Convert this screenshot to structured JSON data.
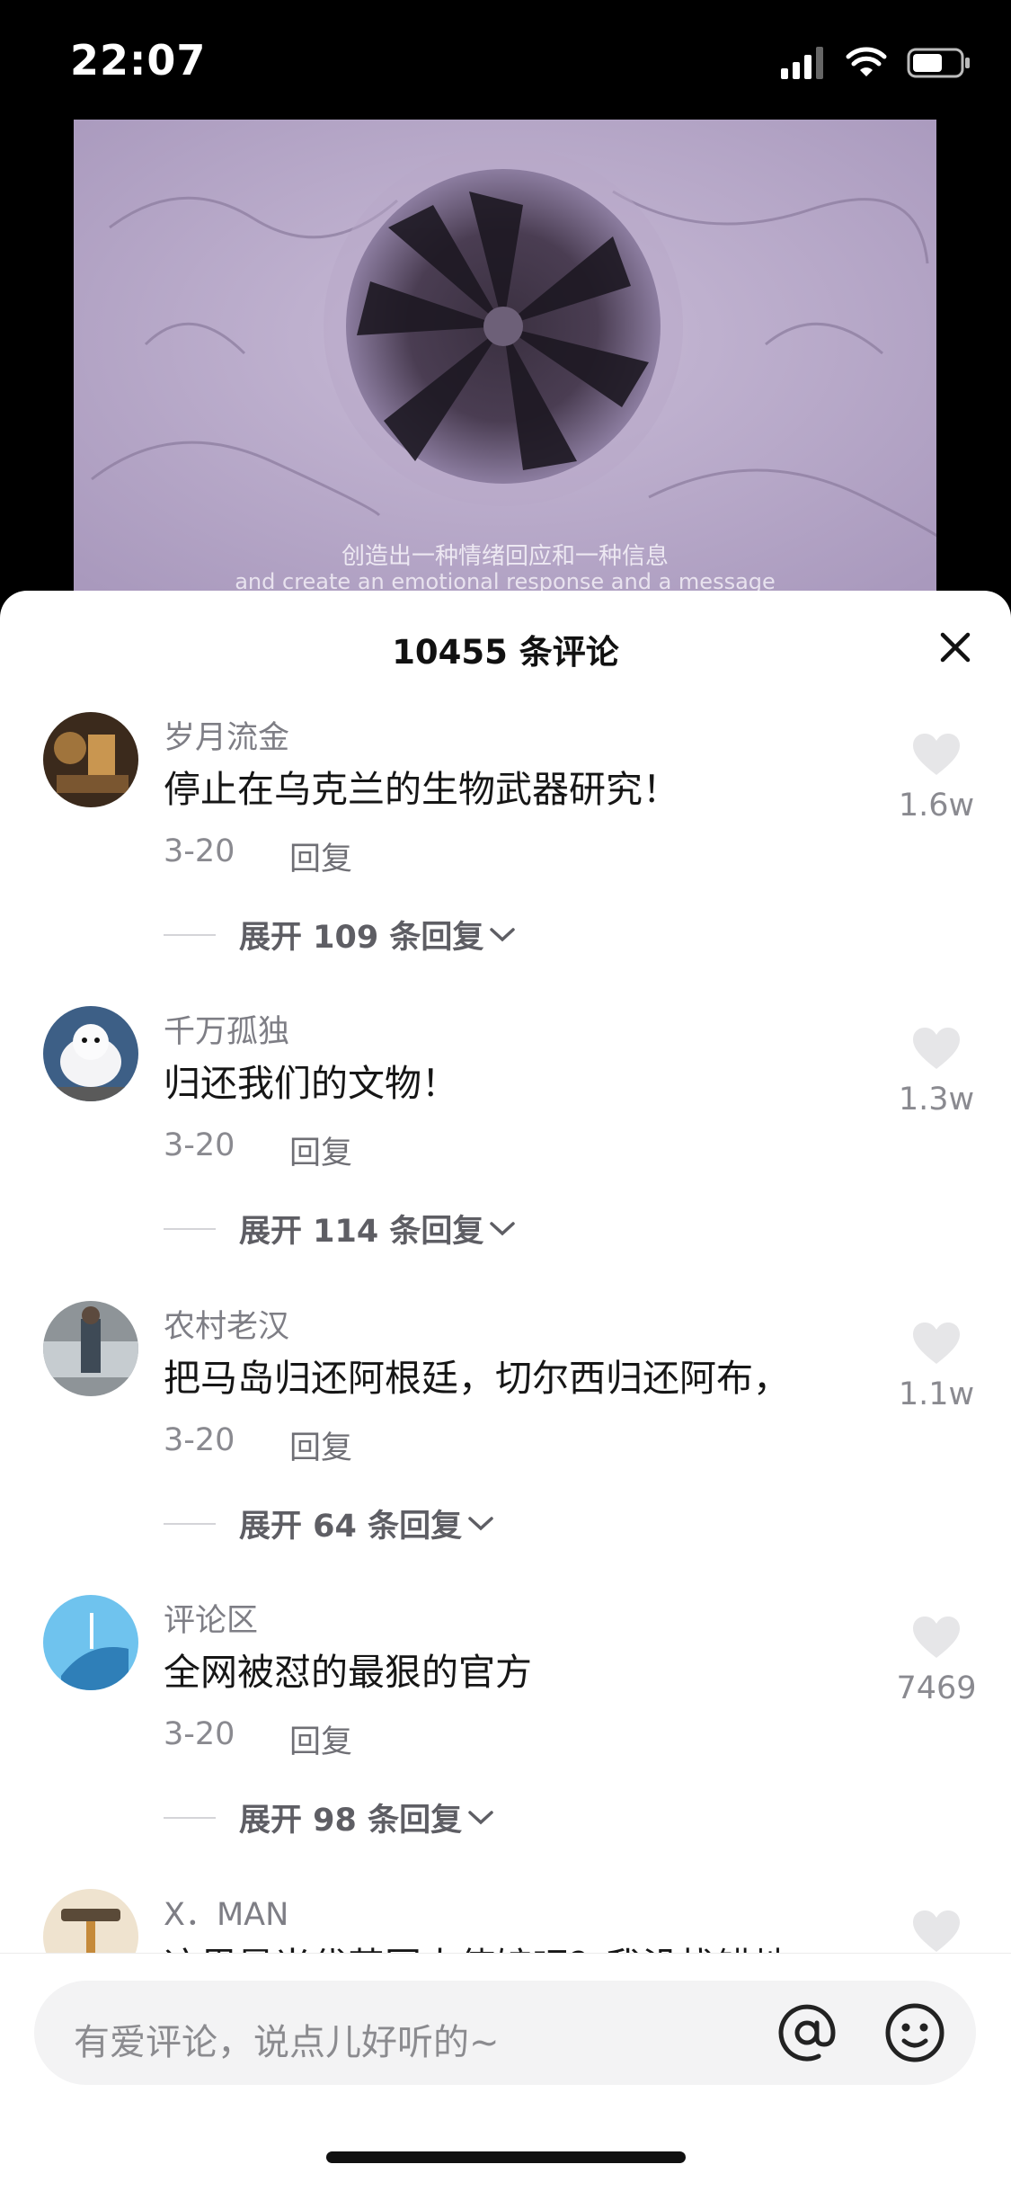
{
  "status_bar": {
    "time": "22:07"
  },
  "video": {
    "subtitle_cn": "创造出一种情绪回应和一种信息",
    "subtitle_en": "and create an emotional response and a message"
  },
  "sheet": {
    "title": "10455 条评论"
  },
  "comments": [
    {
      "user": "岁月流金",
      "text": "停止在乌克兰的生物武器研究！",
      "date": "3-20",
      "reply_label": "回复",
      "expand_label": "展开 109 条回复",
      "likes": "1.6w"
    },
    {
      "user": "千万孤独",
      "text": "归还我们的文物！",
      "date": "3-20",
      "reply_label": "回复",
      "expand_label": "展开 114 条回复",
      "likes": "1.3w"
    },
    {
      "user": "农村老汉",
      "text": "把马岛归还阿根廷，切尔西归还阿布，",
      "date": "3-20",
      "reply_label": "回复",
      "expand_label": "展开 64 条回复",
      "likes": "1.1w"
    },
    {
      "user": "评论区",
      "text": "全网被怼的最狠的官方",
      "date": "3-20",
      "reply_label": "回复",
      "expand_label": "展开 98 条回复",
      "likes": "7469"
    },
    {
      "user": "X．MAN",
      "text": "这里是当代英国大使馆吧？我没找错地",
      "likes": ""
    }
  ],
  "input": {
    "placeholder": "有爱评论，说点儿好听的~"
  },
  "colors": {
    "sheet_bg": "#ffffff",
    "status_bg": "#000000",
    "heart": "#e6e6e8"
  },
  "icons": [
    "signal-icon",
    "wifi-icon",
    "battery-icon",
    "close-icon",
    "heart-icon",
    "chevron-down-icon",
    "at-icon",
    "emoji-icon"
  ]
}
